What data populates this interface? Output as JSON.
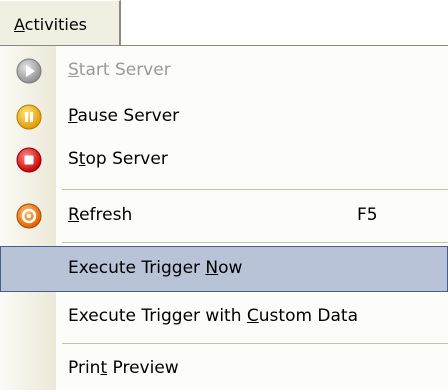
{
  "menubar": {
    "tab": {
      "label_pre": "",
      "label_ul": "A",
      "label_post": "ctivities"
    }
  },
  "menu": {
    "items": [
      {
        "pre": "",
        "ul": "S",
        "post": "tart Server",
        "icon": "start-server-icon",
        "enabled": false
      },
      {
        "pre": "",
        "ul": "P",
        "post": "ause Server",
        "icon": "pause-server-icon",
        "enabled": true
      },
      {
        "pre": "S",
        "ul": "t",
        "post": "op Server",
        "icon": "stop-server-icon",
        "enabled": true
      },
      {
        "pre": "",
        "ul": "R",
        "post": "efresh",
        "icon": "refresh-icon",
        "shortcut": "F5",
        "enabled": true
      },
      {
        "pre": "Execute Trigger ",
        "ul": "N",
        "post": "ow",
        "highlighted": true,
        "enabled": true
      },
      {
        "pre": "Execute Trigger with ",
        "ul": "C",
        "post": "ustom Data",
        "enabled": true
      },
      {
        "pre": "Prin",
        "ul": "t",
        "post": " Preview",
        "enabled": true
      }
    ]
  },
  "colors": {
    "highlight": "#b8c3d8",
    "highlight_border": "#4a5f86",
    "disabled_text": "#9a9a9a",
    "pause": "#f0b400",
    "stop": "#e01818",
    "refresh": "#f07a00"
  }
}
